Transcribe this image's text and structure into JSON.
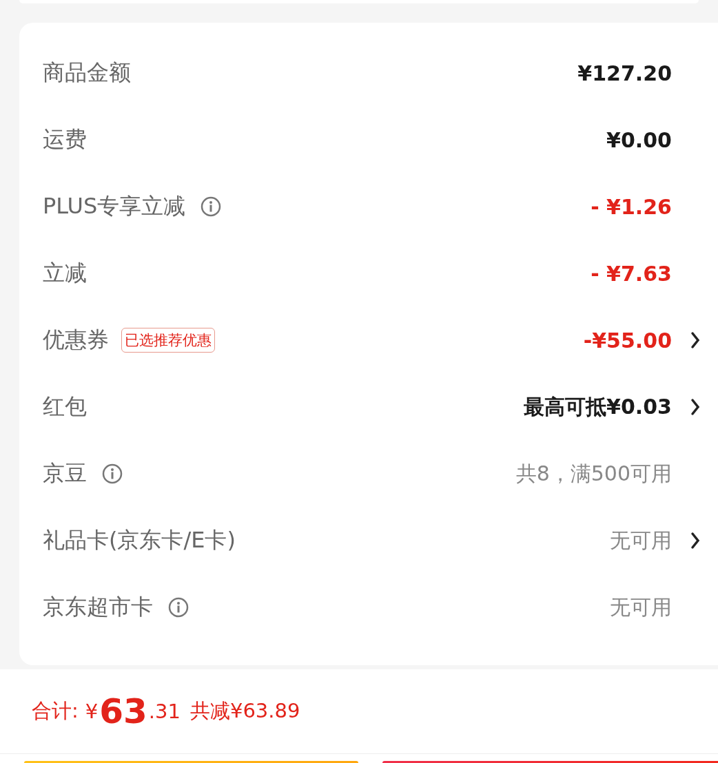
{
  "rows": [
    {
      "label": "商品金额",
      "info": false,
      "value": "¥127.20",
      "kind": "amount",
      "chevron": false
    },
    {
      "label": "运费",
      "info": false,
      "value": "¥0.00",
      "kind": "amount",
      "chevron": false
    },
    {
      "label": "PLUS专享立减",
      "info": true,
      "value": "- ¥1.26",
      "kind": "discount",
      "chevron": false
    },
    {
      "label": "立减",
      "info": false,
      "value": "- ¥7.63",
      "kind": "discount",
      "chevron": false
    },
    {
      "label": "优惠券",
      "info": false,
      "tag": "已选推荐优惠",
      "value": "-¥55.00",
      "kind": "discount",
      "chevron": true
    },
    {
      "label": "红包",
      "info": false,
      "value": "最高可抵¥0.03",
      "kind": "amount",
      "chevron": true
    },
    {
      "label": "京豆",
      "info": true,
      "value": "共8，满500可用",
      "kind": "muted",
      "chevron": false
    },
    {
      "label": "礼品卡(京东卡/E卡)",
      "info": false,
      "value": "无可用",
      "kind": "muted",
      "chevron": true
    },
    {
      "label": "京东超市卡",
      "info": true,
      "value": "无可用",
      "kind": "muted",
      "chevron": false
    }
  ],
  "total": {
    "label": "合计:",
    "currency": "¥",
    "integer": "63",
    "decimal": ".31",
    "saved": "共减¥63.89"
  }
}
